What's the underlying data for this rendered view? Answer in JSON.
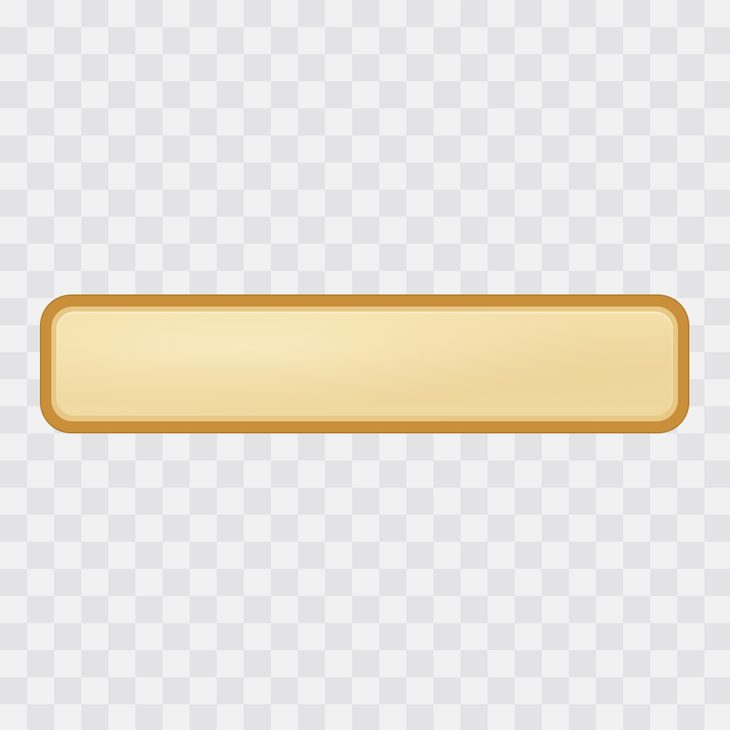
{
  "panel": {
    "label": ""
  },
  "colors": {
    "border": "#c98f3a",
    "inner_rim": "#e7c886",
    "face": "#f1dba4",
    "checker_light": "#f1f1f2",
    "checker_dark": "#e3e3e5"
  }
}
